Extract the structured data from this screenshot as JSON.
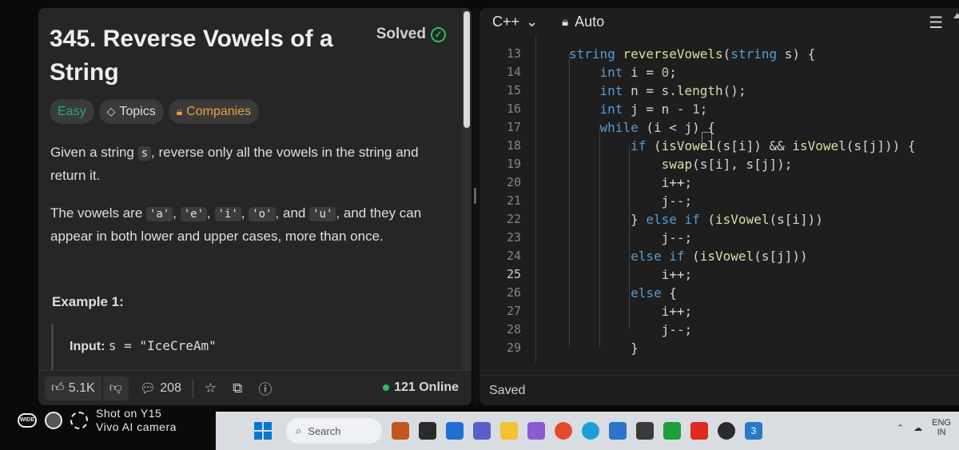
{
  "problem": {
    "title": "345. Reverse Vowels of a String",
    "status": "Solved",
    "tags": [
      "Easy",
      "Topics",
      "Companies"
    ],
    "description_part1": "Given a string ",
    "description_var": "s",
    "description_part2": ", reverse only all the vowels in the string and return it.",
    "vowels_intro": "The vowels are ",
    "vowels": [
      "'a'",
      "'e'",
      "'i'",
      "'o'",
      "'u'"
    ],
    "vowels_and": "and",
    "vowels_outro": ", and they can appear in both lower and upper cases, more than once.",
    "example_title": "Example 1:",
    "example_input_label": "Input:",
    "example_input_value": "s = \"IceCreAm\""
  },
  "footer": {
    "likes": "5.1K",
    "comments": "208",
    "online": "121 Online"
  },
  "editor": {
    "language": "C++",
    "mode": "Auto",
    "status": "Saved",
    "lines": [
      {
        "num": "13",
        "code": "string reverseVowels(string s) {"
      },
      {
        "num": "14",
        "code": "    int i = 0;"
      },
      {
        "num": "15",
        "code": "    int n = s.length();"
      },
      {
        "num": "16",
        "code": "    int j = n - 1;"
      },
      {
        "num": "17",
        "code": "    while (i < j) {"
      },
      {
        "num": "18",
        "code": "        if (isVowel(s[i]) && isVowel(s[j])) {"
      },
      {
        "num": "19",
        "code": "            swap(s[i], s[j]);"
      },
      {
        "num": "20",
        "code": "            i++;"
      },
      {
        "num": "21",
        "code": "            j--;"
      },
      {
        "num": "22",
        "code": "        } else if (isVowel(s[i]))"
      },
      {
        "num": "23",
        "code": "            j--;"
      },
      {
        "num": "24",
        "code": "        else if (isVowel(s[j]))"
      },
      {
        "num": "25",
        "code": "            i++;"
      },
      {
        "num": "26",
        "code": "        else {"
      },
      {
        "num": "27",
        "code": "            i++;"
      },
      {
        "num": "28",
        "code": "            j--;"
      },
      {
        "num": "29",
        "code": "        }"
      }
    ],
    "active_line": "25"
  },
  "watermark": {
    "line1": "Shot on Y15",
    "line2": "Vivo AI camera",
    "badge": "WIDE"
  },
  "taskbar": {
    "search_placeholder": "Search",
    "lang_line1": "ENG",
    "lang_line2": "IN",
    "notification_count": "3"
  },
  "colors": {
    "accent_green": "#2cbb5d",
    "easy": "#27a889",
    "companies": "#e8a43c",
    "keyword": "#569cd6",
    "function": "#dcdcaa",
    "number": "#b5cea8"
  }
}
